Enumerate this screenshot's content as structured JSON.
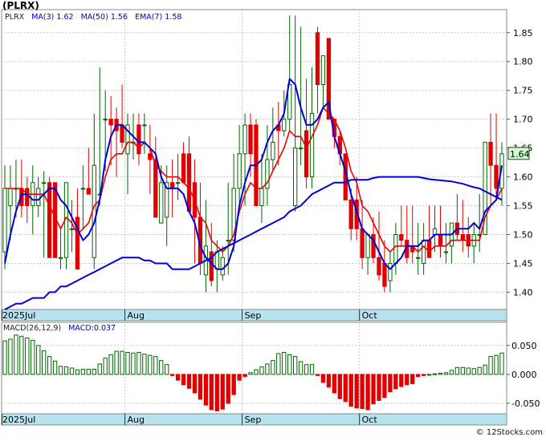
{
  "header": {
    "title": "(PLRX)",
    "legend": {
      "symbol": "PLRX",
      "ma3_label": "MA(3)",
      "ma3_value": "1.62",
      "ma50_label": "MA(50)",
      "ma50_value": "1.56",
      "ema7_label": "EMA(7)",
      "ema7_value": "1.58"
    },
    "macd_legend": {
      "label": "MACD(26,12,9)",
      "value": "MACD:0.037"
    },
    "credit": "© 12Stocks.com"
  },
  "colors": {
    "up": "#006600",
    "down": "#e00000",
    "ma_blue": "#0000dd",
    "ema_red": "#ee0000",
    "axis_strip": "#b7e3f0",
    "last_badge": "#ccffcc"
  },
  "chart_data": [
    {
      "type": "candlestick",
      "title": "",
      "x": [
        "Jul 1",
        "Jul 2",
        "Jul 3",
        "Jul 7",
        "Jul 8",
        "Jul 9",
        "Jul 10",
        "Jul 11",
        "Jul 14",
        "Jul 15",
        "Jul 16",
        "Jul 17",
        "Jul 18",
        "Jul 21",
        "Jul 22",
        "Jul 23",
        "Jul 24",
        "Jul 25",
        "Jul 28",
        "Jul 29",
        "Jul 30",
        "Jul 31",
        "Aug 1",
        "Aug 4",
        "Aug 5",
        "Aug 6",
        "Aug 7",
        "Aug 8",
        "Aug 11",
        "Aug 12",
        "Aug 13",
        "Aug 14",
        "Aug 15",
        "Aug 18",
        "Aug 19",
        "Aug 20",
        "Aug 21",
        "Aug 22",
        "Aug 25",
        "Aug 26",
        "Aug 27",
        "Aug 28",
        "Aug 29",
        "Sep 2",
        "Sep 3",
        "Sep 4",
        "Sep 5",
        "Sep 8",
        "Sep 9",
        "Sep 10",
        "Sep 11",
        "Sep 12",
        "Sep 15",
        "Sep 16",
        "Sep 17",
        "Sep 18",
        "Sep 19",
        "Sep 22",
        "Sep 23",
        "Sep 24",
        "Sep 25",
        "Sep 26",
        "Sep 29",
        "Sep 30",
        "Oct 1",
        "Oct 2",
        "Oct 3",
        "Oct 6",
        "Oct 7",
        "Oct 8",
        "Oct 9",
        "Oct 10",
        "Oct 13",
        "Oct 14",
        "Oct 15",
        "Oct 16",
        "Oct 17",
        "Oct 20",
        "Oct 21",
        "Oct 22",
        "Oct 23",
        "Oct 24",
        "Oct 27",
        "Oct 28",
        "Oct 29",
        "Oct 30",
        "Oct 31",
        "Nov 3",
        "Nov 4",
        "Nov 5"
      ],
      "open": [
        1.47,
        1.55,
        1.58,
        1.58,
        1.58,
        1.55,
        1.55,
        1.59,
        1.59,
        1.59,
        1.46,
        1.46,
        1.51,
        1.53,
        1.58,
        1.58,
        1.46,
        1.57,
        1.7,
        1.7,
        1.7,
        1.69,
        1.64,
        1.66,
        1.69,
        1.69,
        1.64,
        1.63,
        1.52,
        1.53,
        1.59,
        1.59,
        1.64,
        1.64,
        1.59,
        1.53,
        1.43,
        1.47,
        1.44,
        1.43,
        1.49,
        1.49,
        1.58,
        1.64,
        1.69,
        1.69,
        1.55,
        1.58,
        1.63,
        1.69,
        1.68,
        1.7,
        1.55,
        1.65,
        1.68,
        1.6,
        1.85,
        1.76,
        1.84,
        1.7,
        1.67,
        1.64,
        1.56,
        1.56,
        1.51,
        1.46,
        1.5,
        1.46,
        1.45,
        1.42,
        1.45,
        1.5,
        1.49,
        1.48,
        1.46,
        1.45,
        1.49,
        1.5,
        1.5,
        1.47,
        1.48,
        1.52,
        1.5,
        1.5,
        1.48,
        1.5,
        1.5,
        1.66,
        1.62,
        1.58
      ],
      "high": [
        1.62,
        1.62,
        1.63,
        1.63,
        1.6,
        1.62,
        1.6,
        1.61,
        1.6,
        1.59,
        1.51,
        1.51,
        1.56,
        1.58,
        1.62,
        1.65,
        1.71,
        1.79,
        1.75,
        1.74,
        1.72,
        1.76,
        1.71,
        1.71,
        1.71,
        1.71,
        1.69,
        1.67,
        1.62,
        1.62,
        1.63,
        1.64,
        1.66,
        1.67,
        1.63,
        1.59,
        1.56,
        1.52,
        1.49,
        1.48,
        1.59,
        1.64,
        1.69,
        1.71,
        1.71,
        1.7,
        1.64,
        1.69,
        1.72,
        1.73,
        1.75,
        1.88,
        1.88,
        1.86,
        1.77,
        1.79,
        1.86,
        1.81,
        1.84,
        1.7,
        1.68,
        1.64,
        1.58,
        1.6,
        1.56,
        1.5,
        1.53,
        1.54,
        1.49,
        1.47,
        1.52,
        1.55,
        1.55,
        1.55,
        1.52,
        1.52,
        1.55,
        1.55,
        1.55,
        1.52,
        1.52,
        1.57,
        1.56,
        1.53,
        1.52,
        1.57,
        1.62,
        1.71,
        1.71,
        1.66
      ],
      "low": [
        1.44,
        1.49,
        1.53,
        1.53,
        1.52,
        1.5,
        1.53,
        1.46,
        1.53,
        1.46,
        1.44,
        1.44,
        1.47,
        1.44,
        1.51,
        1.57,
        1.44,
        1.55,
        1.61,
        1.62,
        1.6,
        1.65,
        1.57,
        1.63,
        1.62,
        1.64,
        1.57,
        1.55,
        1.54,
        1.48,
        1.53,
        1.56,
        1.59,
        1.55,
        1.45,
        1.43,
        1.4,
        1.41,
        1.4,
        1.42,
        1.43,
        1.47,
        1.55,
        1.55,
        1.6,
        1.6,
        1.52,
        1.55,
        1.61,
        1.62,
        1.67,
        1.68,
        1.54,
        1.62,
        1.58,
        1.58,
        1.71,
        1.72,
        1.7,
        1.65,
        1.62,
        1.57,
        1.49,
        1.49,
        1.44,
        1.43,
        1.45,
        1.42,
        1.4,
        1.4,
        1.43,
        1.48,
        1.45,
        1.45,
        1.43,
        1.43,
        1.46,
        1.47,
        1.46,
        1.45,
        1.45,
        1.49,
        1.47,
        1.46,
        1.45,
        1.47,
        1.5,
        1.55,
        1.56,
        1.55
      ],
      "close": [
        1.58,
        1.58,
        1.58,
        1.55,
        1.55,
        1.59,
        1.58,
        1.59,
        1.46,
        1.46,
        1.46,
        1.59,
        1.51,
        1.44,
        1.58,
        1.57,
        1.62,
        1.57,
        1.7,
        1.69,
        1.68,
        1.66,
        1.69,
        1.66,
        1.64,
        1.69,
        1.63,
        1.53,
        1.59,
        1.59,
        1.58,
        1.59,
        1.59,
        1.54,
        1.53,
        1.45,
        1.48,
        1.42,
        1.47,
        1.46,
        1.49,
        1.58,
        1.64,
        1.69,
        1.64,
        1.55,
        1.58,
        1.63,
        1.66,
        1.68,
        1.7,
        1.76,
        1.65,
        1.65,
        1.6,
        1.71,
        1.76,
        1.81,
        1.7,
        1.67,
        1.64,
        1.56,
        1.51,
        1.51,
        1.46,
        1.5,
        1.46,
        1.43,
        1.41,
        1.45,
        1.5,
        1.49,
        1.46,
        1.47,
        1.46,
        1.49,
        1.46,
        1.51,
        1.48,
        1.47,
        1.52,
        1.5,
        1.49,
        1.48,
        1.5,
        1.5,
        1.66,
        1.62,
        1.58,
        1.64
      ],
      "last_price": "1.64",
      "ma3": [
        1.45,
        1.5,
        1.54,
        1.57,
        1.57,
        1.56,
        1.56,
        1.57,
        1.58,
        1.58,
        1.56,
        1.55,
        1.53,
        1.51,
        1.49,
        1.5,
        1.52,
        1.56,
        1.63,
        1.67,
        1.69,
        1.69,
        1.68,
        1.67,
        1.66,
        1.66,
        1.65,
        1.64,
        1.6,
        1.58,
        1.58,
        1.58,
        1.57,
        1.54,
        1.52,
        1.48,
        1.46,
        1.45,
        1.44,
        1.44,
        1.45,
        1.48,
        1.55,
        1.59,
        1.62,
        1.62,
        1.63,
        1.66,
        1.68,
        1.69,
        1.71,
        1.77,
        1.76,
        1.72,
        1.69,
        1.69,
        1.7,
        1.72,
        1.73,
        1.67,
        1.64,
        1.61,
        1.57,
        1.54,
        1.51,
        1.5,
        1.49,
        1.47,
        1.45,
        1.44,
        1.45,
        1.46,
        1.48,
        1.48,
        1.48,
        1.49,
        1.49,
        1.5,
        1.5,
        1.5,
        1.5,
        1.51,
        1.51,
        1.51,
        1.52,
        1.51,
        1.54,
        1.55,
        1.56,
        1.62
      ],
      "ma50": [
        1.37,
        1.375,
        1.38,
        1.38,
        1.385,
        1.39,
        1.39,
        1.39,
        1.4,
        1.4,
        1.41,
        1.41,
        1.415,
        1.42,
        1.425,
        1.43,
        1.435,
        1.44,
        1.445,
        1.45,
        1.455,
        1.46,
        1.46,
        1.46,
        1.46,
        1.455,
        1.455,
        1.45,
        1.45,
        1.45,
        1.44,
        1.44,
        1.44,
        1.44,
        1.445,
        1.45,
        1.455,
        1.46,
        1.47,
        1.475,
        1.48,
        1.485,
        1.49,
        1.495,
        1.5,
        1.505,
        1.51,
        1.515,
        1.52,
        1.525,
        1.53,
        1.54,
        1.545,
        1.55,
        1.56,
        1.57,
        1.575,
        1.58,
        1.585,
        1.59,
        1.59,
        1.59,
        1.595,
        1.595,
        1.595,
        1.595,
        1.598,
        1.6,
        1.6,
        1.6,
        1.6,
        1.6,
        1.6,
        1.6,
        1.6,
        1.598,
        1.596,
        1.595,
        1.594,
        1.593,
        1.592,
        1.59,
        1.588,
        1.585,
        1.582,
        1.58,
        1.575,
        1.57,
        1.565,
        1.56
      ],
      "ema7": [
        1.58,
        1.58,
        1.58,
        1.58,
        1.57,
        1.57,
        1.57,
        1.57,
        1.55,
        1.53,
        1.51,
        1.53,
        1.52,
        1.5,
        1.51,
        1.52,
        1.55,
        1.56,
        1.6,
        1.63,
        1.64,
        1.64,
        1.66,
        1.66,
        1.65,
        1.66,
        1.65,
        1.62,
        1.61,
        1.6,
        1.6,
        1.6,
        1.59,
        1.58,
        1.56,
        1.53,
        1.52,
        1.49,
        1.48,
        1.47,
        1.48,
        1.5,
        1.54,
        1.57,
        1.59,
        1.58,
        1.58,
        1.59,
        1.61,
        1.63,
        1.65,
        1.68,
        1.67,
        1.67,
        1.65,
        1.67,
        1.69,
        1.72,
        1.71,
        1.7,
        1.68,
        1.65,
        1.61,
        1.59,
        1.55,
        1.54,
        1.52,
        1.5,
        1.48,
        1.47,
        1.48,
        1.48,
        1.48,
        1.48,
        1.47,
        1.48,
        1.47,
        1.48,
        1.48,
        1.48,
        1.49,
        1.49,
        1.49,
        1.49,
        1.49,
        1.49,
        1.53,
        1.55,
        1.56,
        1.58
      ],
      "ylim": [
        1.37,
        1.89
      ],
      "y_ticks": [
        1.4,
        1.45,
        1.5,
        1.55,
        1.6,
        1.65,
        1.7,
        1.75,
        1.8,
        1.85
      ],
      "y_tick_labels": [
        "1.40",
        "1.45",
        "1.50",
        "1.55",
        "1.60",
        "1.65",
        "1.70",
        "1.75",
        "1.80",
        "1.85"
      ],
      "x_tick_labels": [
        {
          "index": 0,
          "label": "2025Jul"
        },
        {
          "index": 22,
          "label": "Aug"
        },
        {
          "index": 43,
          "label": "Sep"
        },
        {
          "index": 64,
          "label": "Oct"
        }
      ],
      "grid": true
    },
    {
      "type": "bar",
      "title": "",
      "values": [
        0.058,
        0.061,
        0.068,
        0.066,
        0.063,
        0.059,
        0.05,
        0.041,
        0.031,
        0.023,
        0.014,
        0.013,
        0.011,
        0.008,
        0.009,
        0.009,
        0.009,
        0.018,
        0.028,
        0.034,
        0.04,
        0.04,
        0.038,
        0.037,
        0.038,
        0.035,
        0.033,
        0.031,
        0.024,
        0.017,
        -0.002,
        -0.01,
        -0.018,
        -0.024,
        -0.032,
        -0.043,
        -0.053,
        -0.061,
        -0.063,
        -0.06,
        -0.05,
        -0.035,
        -0.01,
        -0.004,
        0.003,
        0.008,
        0.013,
        0.018,
        0.024,
        0.036,
        0.038,
        0.034,
        0.031,
        0.022,
        0.017,
        0.017,
        -0.002,
        -0.014,
        -0.022,
        -0.032,
        -0.042,
        -0.047,
        -0.055,
        -0.058,
        -0.059,
        -0.061,
        -0.051,
        -0.045,
        -0.04,
        -0.03,
        -0.025,
        -0.021,
        -0.018,
        -0.016,
        -0.004,
        -0.002,
        0.0,
        0.001,
        0.002,
        0.003,
        0.007,
        0.012,
        0.012,
        0.011,
        0.01,
        0.012,
        0.016,
        0.031,
        0.033,
        0.037
      ],
      "ylim": [
        -0.068,
        0.09
      ],
      "y_ticks": [
        -0.05,
        0.0,
        0.05
      ],
      "y_tick_labels": [
        "-0.050",
        "0.000",
        "0.050"
      ],
      "x_tick_labels": [
        {
          "index": 0,
          "label": "2025Jul"
        },
        {
          "index": 22,
          "label": "Aug"
        },
        {
          "index": 43,
          "label": "Sep"
        },
        {
          "index": 64,
          "label": "Oct"
        }
      ]
    }
  ]
}
